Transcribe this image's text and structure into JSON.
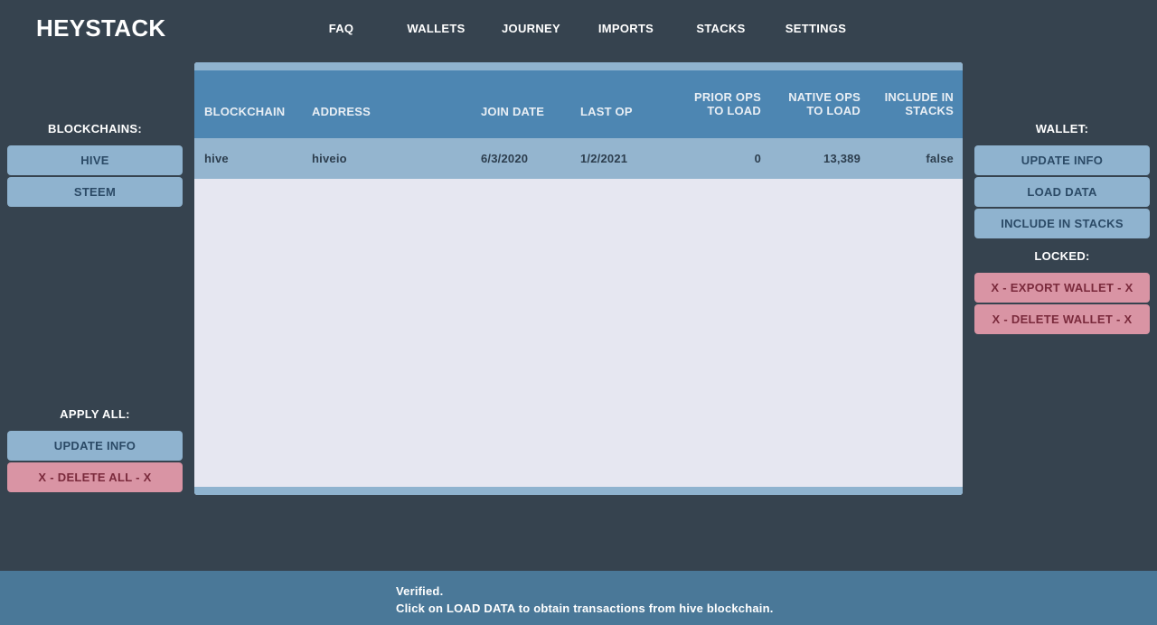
{
  "app": {
    "title": "HEYSTACK"
  },
  "nav": {
    "items": [
      "FAQ",
      "WALLETS",
      "JOURNEY",
      "IMPORTS",
      "STACKS",
      "SETTINGS"
    ]
  },
  "left_panel": {
    "blockchains_label": "BLOCKCHAINS:",
    "blockchains": [
      "HIVE",
      "STEEM"
    ],
    "apply_all_label": "APPLY ALL:",
    "update_info": "UPDATE INFO",
    "delete_all": "X - DELETE ALL - X"
  },
  "right_panel": {
    "wallet_label": "WALLET:",
    "update_info": "UPDATE INFO",
    "load_data": "LOAD DATA",
    "include_in_stacks": "INCLUDE IN STACKS",
    "locked_label": "LOCKED:",
    "export_wallet": "X - EXPORT WALLET - X",
    "delete_wallet": "X - DELETE WALLET - X"
  },
  "table": {
    "headers": {
      "blockchain": "BLOCKCHAIN",
      "address": "ADDRESS",
      "join_date": "JOIN DATE",
      "last_op": "LAST OP",
      "prior_ops_1": "PRIOR OPS",
      "prior_ops_2": "TO LOAD",
      "native_ops_1": "NATIVE OPS",
      "native_ops_2": "TO LOAD",
      "include_1": "INCLUDE IN",
      "include_2": "STACKS"
    },
    "rows": [
      {
        "blockchain": "hive",
        "address": "hiveio",
        "join_date": "6/3/2020",
        "last_op": "1/2/2021",
        "prior_ops": "0",
        "native_ops": "13,389",
        "include": "false"
      }
    ]
  },
  "status": {
    "line1": "Verified.",
    "line2": "Click on LOAD DATA to obtain transactions from hive blockchain."
  },
  "colors": {
    "background": "#36434f",
    "button_blue": "#8fb3cf",
    "button_red": "#d994a4",
    "table_header": "#4d86b2",
    "selected_row": "#94b5cf",
    "footer": "#4a7898"
  }
}
